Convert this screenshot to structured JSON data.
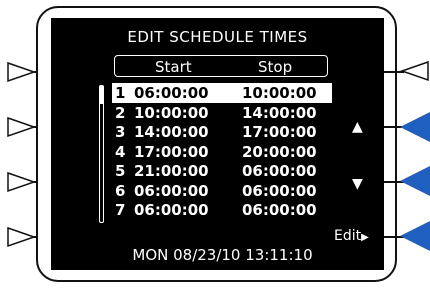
{
  "title": "EDIT SCHEDULE TIMES",
  "columns": {
    "start": "Start",
    "stop": "Stop"
  },
  "rows": [
    {
      "n": "1",
      "start": "06:00:00",
      "stop": "10:00:00",
      "selected": true
    },
    {
      "n": "2",
      "start": "10:00:00",
      "stop": "14:00:00"
    },
    {
      "n": "3",
      "start": "14:00:00",
      "stop": "17:00:00"
    },
    {
      "n": "4",
      "start": "17:00:00",
      "stop": "20:00:00"
    },
    {
      "n": "5",
      "start": "21:00:00",
      "stop": "06:00:00"
    },
    {
      "n": "6",
      "start": "06:00:00",
      "stop": "06:00:00"
    },
    {
      "n": "7",
      "start": "06:00:00",
      "stop": "06:00:00"
    }
  ],
  "softkeys": {
    "up": "▲",
    "down": "▼",
    "edit": "Edit",
    "edit_arrow": "▶"
  },
  "status": "MON 08/23/10 13:11:10",
  "colors": {
    "active_key": "#1f5fbf",
    "inactive_key": "#ffffff",
    "screen": "#000000"
  },
  "icons": {
    "left_keys": "triangle-right-outline",
    "right_top_key": "triangle-left-outline",
    "right_active_keys": "triangle-left-filled"
  }
}
